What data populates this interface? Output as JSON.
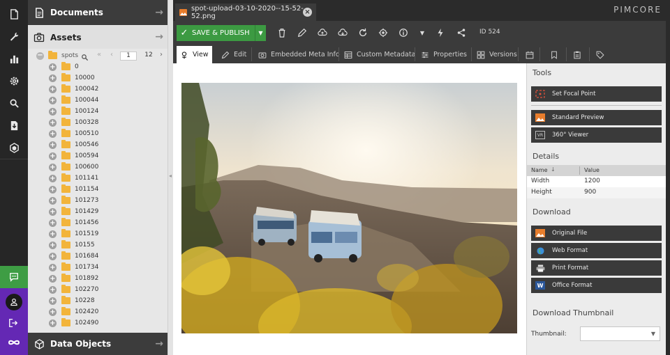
{
  "app": {
    "logo": "PIMCORE"
  },
  "rail": {
    "icons": [
      "file-icon",
      "wrench-icon",
      "chart-icon",
      "gear-icon",
      "search-icon",
      "download-icon",
      "cube-icon",
      "chat-icon",
      "user-icon",
      "logout-icon",
      "infinity-icon"
    ]
  },
  "tree": {
    "documents_label": "Documents",
    "assets_label": "Assets",
    "root_label": "spots",
    "pager_current": "1",
    "pager_total": "12",
    "items": [
      "0",
      "10000",
      "100042",
      "100044",
      "100124",
      "100328",
      "100510",
      "100546",
      "100594",
      "100600",
      "101141",
      "101154",
      "101273",
      "101429",
      "101456",
      "101519",
      "10155",
      "101684",
      "101734",
      "101892",
      "102270",
      "10228",
      "102420",
      "102490"
    ],
    "data_objects_label": "Data Objects"
  },
  "tab": {
    "title": "spot-upload-03-10-2020--15-52-52.png"
  },
  "toolbar": {
    "save_label": "SAVE & PUBLISH",
    "id_label": "ID 524"
  },
  "subtabs": {
    "view": "View",
    "edit": "Edit",
    "embedded_meta": "Embedded Meta Info",
    "custom_metadata": "Custom Metadata",
    "properties": "Properties",
    "versions": "Versions"
  },
  "sidebar": {
    "tools_title": "Tools",
    "set_focal_point": "Set Focal Point",
    "standard_preview": "Standard Preview",
    "viewer_360": "360° Viewer",
    "details_title": "Details",
    "details_headers": {
      "name": "Name",
      "value": "Value"
    },
    "details_rows": [
      {
        "name": "Width",
        "value": "1200"
      },
      {
        "name": "Height",
        "value": "900"
      }
    ],
    "download_title": "Download",
    "original_file": "Original File",
    "web_format": "Web Format",
    "print_format": "Print Format",
    "office_format": "Office Format",
    "download_thumb_title": "Download Thumbnail",
    "thumbnail_label": "Thumbnail:",
    "thumbnail_value": ""
  }
}
